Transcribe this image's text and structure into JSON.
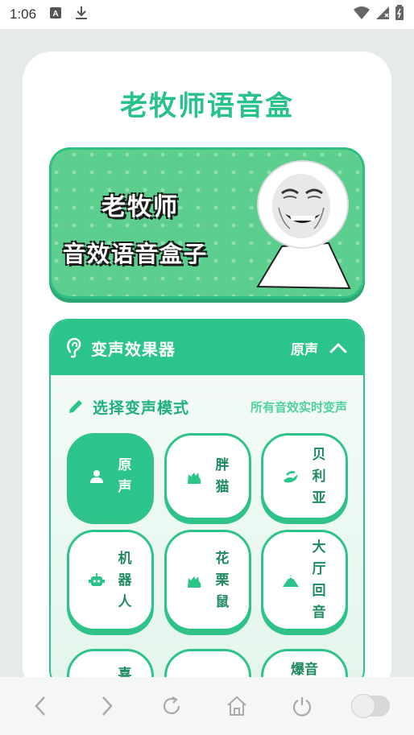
{
  "status_bar": {
    "time": "1:06",
    "icons": [
      "notification-a-icon",
      "download-icon",
      "wifi-icon",
      "signal-icon",
      "battery-icon"
    ]
  },
  "app": {
    "title": "老牧师语音盒",
    "accent_color": "#2bc58c"
  },
  "banner": {
    "line1": "老牧师",
    "line2": "音效语音盒子"
  },
  "voice_panel": {
    "title": "变声效果器",
    "current_effect": "原声",
    "mode_title": "选择变声模式",
    "mode_hint": "所有音效实时变声",
    "buttons": [
      {
        "label": "原声",
        "icon": "person-icon",
        "active": true
      },
      {
        "label": "胖猫",
        "icon": "cat-icon",
        "active": false
      },
      {
        "label": "贝利亚",
        "icon": "dragon-icon",
        "active": false
      },
      {
        "label": "机器人",
        "icon": "robot-icon",
        "active": false
      },
      {
        "label": "花栗鼠",
        "icon": "cat-icon",
        "active": false
      },
      {
        "label": "大厅回音",
        "icon": "mountain-icon",
        "active": false
      },
      {
        "label": "",
        "icon": "",
        "active": false
      },
      {
        "label": "",
        "icon": "",
        "active": false
      },
      {
        "label": "爆音",
        "icon": "",
        "active": false
      }
    ],
    "partial_labels": [
      "喜"
    ]
  },
  "nav_bar": {
    "items": [
      "back-icon",
      "forward-icon",
      "refresh-icon",
      "home-icon",
      "power-icon",
      "toggle-switch"
    ]
  }
}
